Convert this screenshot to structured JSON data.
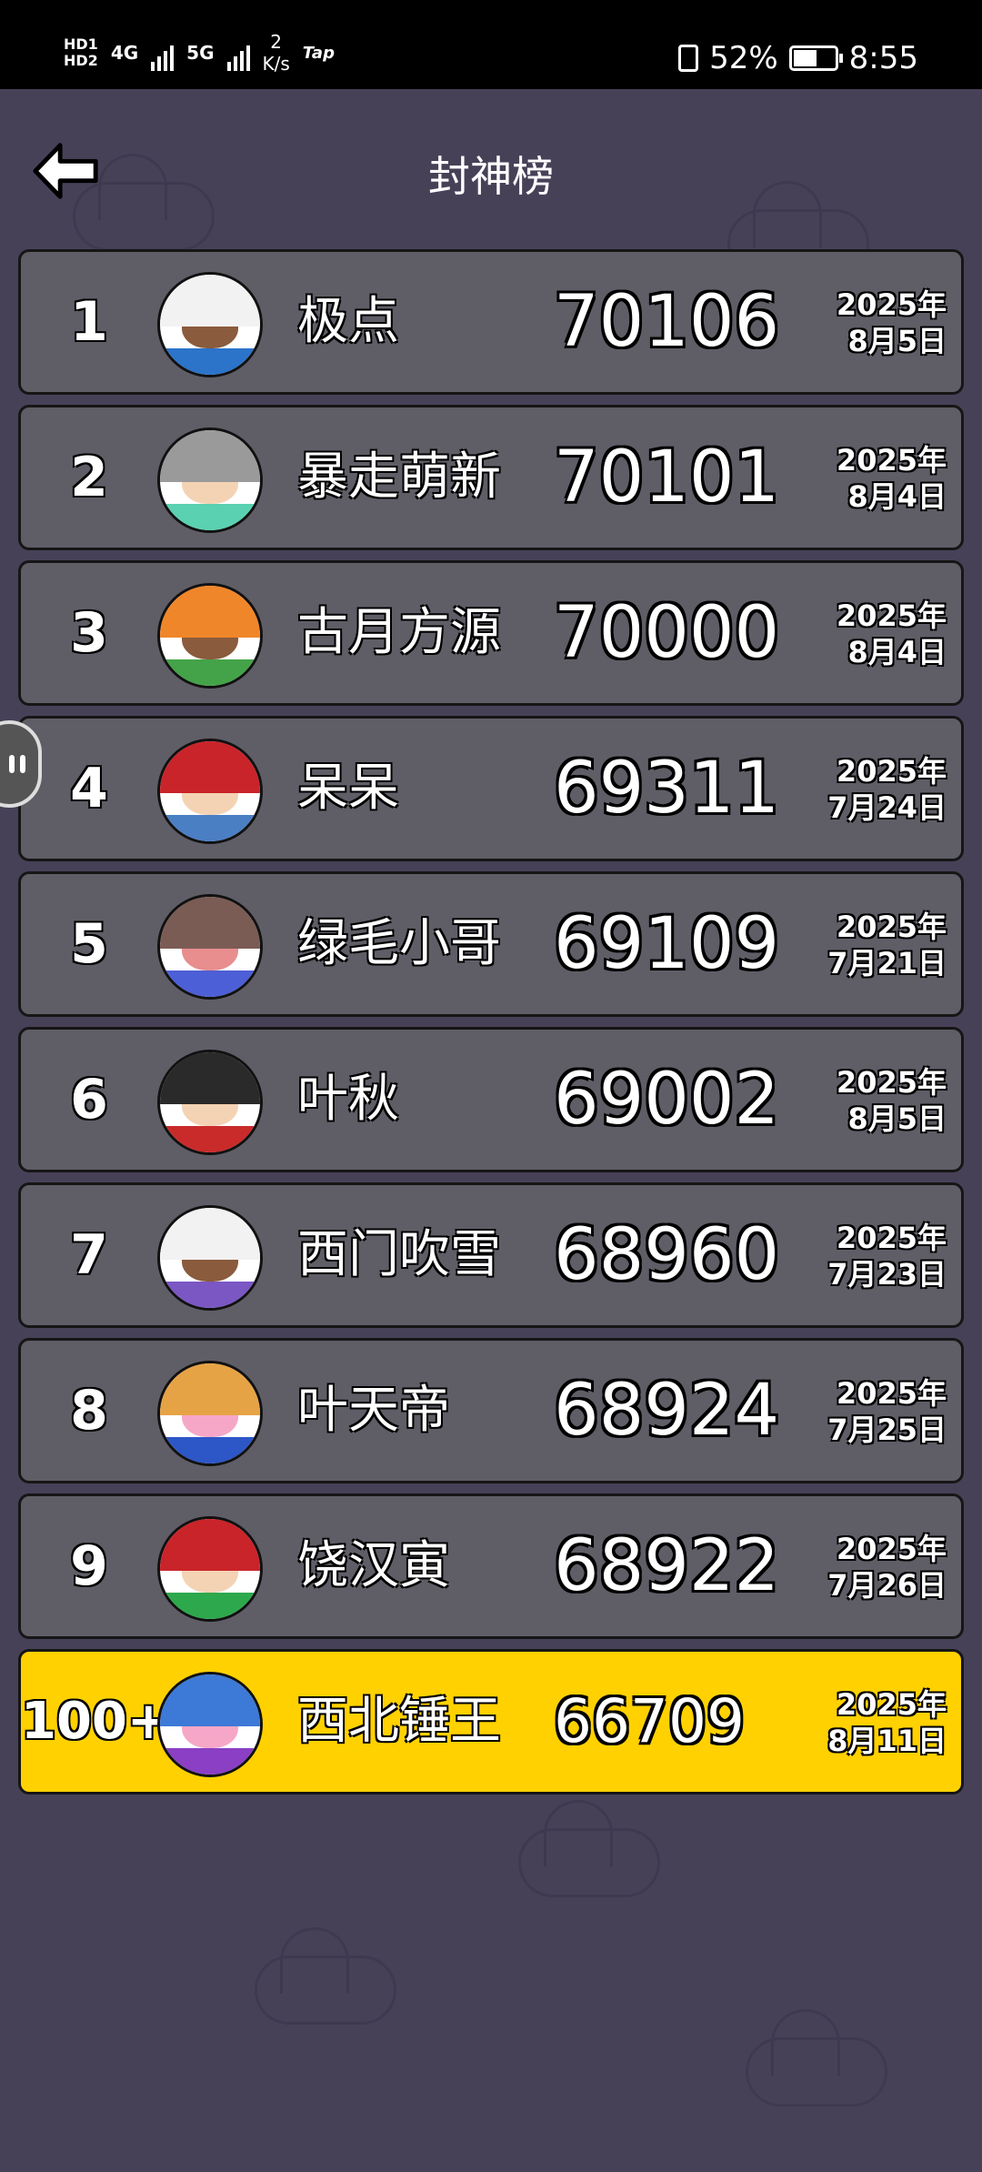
{
  "status_bar": {
    "hd1": "HD1",
    "hd2": "HD2",
    "sim1": "4G",
    "sim2": "5G",
    "net_speed_value": "2",
    "net_speed_unit": "K/s",
    "app_tag": "Tap",
    "battery": "52%",
    "time": "8:55"
  },
  "header": {
    "title": "封神榜"
  },
  "leaderboard": [
    {
      "rank": "1",
      "name": "极点",
      "score": "70106",
      "year": "2025年",
      "date": "8月5日",
      "hair": "#f2f2f2",
      "face": "#8a5b3c",
      "body": "#2b74c9"
    },
    {
      "rank": "2",
      "name": "暴走萌新",
      "score": "70101",
      "year": "2025年",
      "date": "8月4日",
      "hair": "#9a9a9a",
      "face": "#f4d3b4",
      "body": "#5ad1b0"
    },
    {
      "rank": "3",
      "name": "古月方源",
      "score": "70000",
      "year": "2025年",
      "date": "8月4日",
      "hair": "#f0862a",
      "face": "#8a5b3c",
      "body": "#44a348"
    },
    {
      "rank": "4",
      "name": "呆呆",
      "score": "69311",
      "year": "2025年",
      "date": "7月24日",
      "hair": "#c9242a",
      "face": "#f4d3b4",
      "body": "#4b7fc4"
    },
    {
      "rank": "5",
      "name": "绿毛小哥",
      "score": "69109",
      "year": "2025年",
      "date": "7月21日",
      "hair": "#7a5c55",
      "face": "#e88e8e",
      "body": "#4d5fd6"
    },
    {
      "rank": "6",
      "name": "叶秋",
      "score": "69002",
      "year": "2025年",
      "date": "8月5日",
      "hair": "#2a2a2a",
      "face": "#f4d3b4",
      "body": "#c92b2b"
    },
    {
      "rank": "7",
      "name": "西门吹雪",
      "score": "68960",
      "year": "2025年",
      "date": "7月23日",
      "hair": "#f2f2f2",
      "face": "#8a5b3c",
      "body": "#7b57c4"
    },
    {
      "rank": "8",
      "name": "叶天帝",
      "score": "68924",
      "year": "2025年",
      "date": "7月25日",
      "hair": "#e6a346",
      "face": "#f6a7c8",
      "body": "#2d56c7"
    },
    {
      "rank": "9",
      "name": "饶汉寅",
      "score": "68922",
      "year": "2025年",
      "date": "7月26日",
      "hair": "#c9242a",
      "face": "#f4d3b4",
      "body": "#2ea84c"
    }
  ],
  "my_entry": {
    "rank": "100+",
    "name": "西北锤王",
    "score": "66709",
    "year": "2025年",
    "date": "8月11日",
    "hair": "#3d79d6",
    "face": "#f6a7c8",
    "body": "#8a3fc4"
  },
  "colors": {
    "background": "#474158",
    "row": "#5f5d66",
    "highlight": "#ffd100"
  }
}
